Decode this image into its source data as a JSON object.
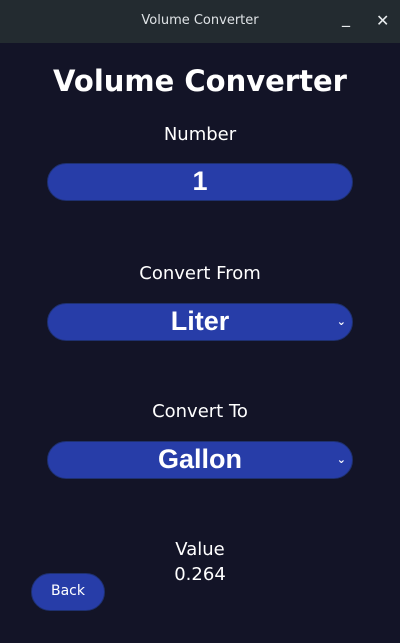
{
  "window": {
    "title": "Volume Converter",
    "minimize_icon": "minimize-icon",
    "close_icon": "close-icon"
  },
  "heading": "Volume Converter",
  "number": {
    "label": "Number",
    "value": "1"
  },
  "convert_from": {
    "label": "Convert From",
    "selected": "Liter"
  },
  "convert_to": {
    "label": "Convert To",
    "selected": "Gallon"
  },
  "result": {
    "label": "Value",
    "value": "0.264"
  },
  "back_label": "Back",
  "colors": {
    "background": "#131427",
    "field": "#273da8",
    "titlebar": "#232b30"
  }
}
